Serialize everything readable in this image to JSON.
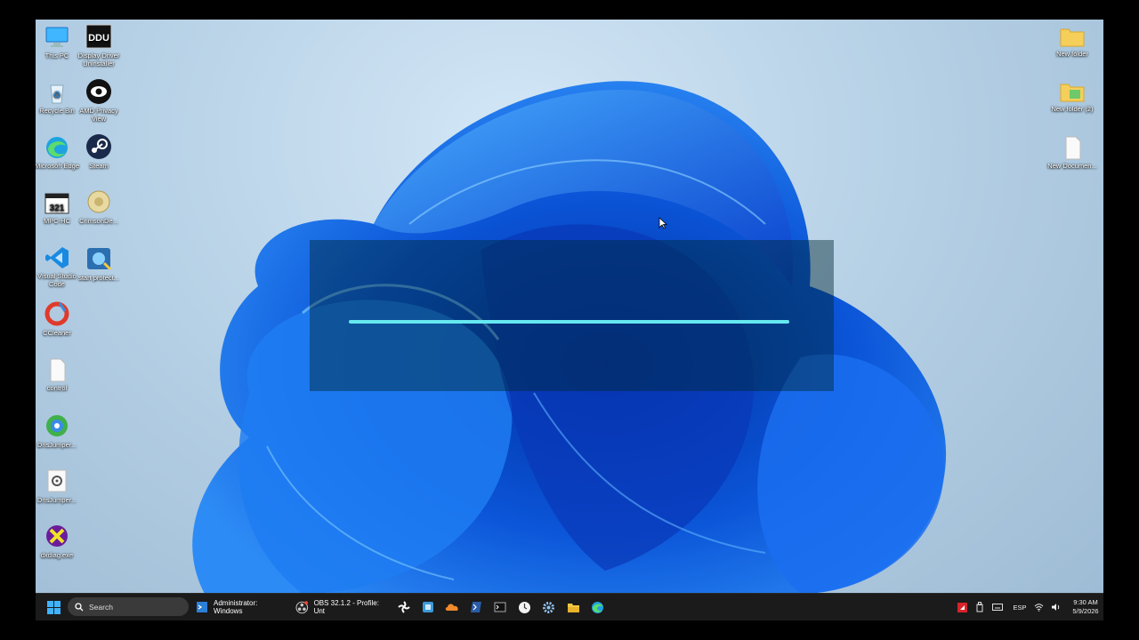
{
  "desktop": {
    "left_icons": [
      {
        "label": "This PC",
        "icon": "this-pc-icon"
      },
      {
        "label": "Display Driver Uninstaller",
        "icon": "display-driver-uninstaller-icon"
      },
      {
        "label": "Recycle Bin",
        "icon": "recycle-bin-icon"
      },
      {
        "label": "AMD Privacy View",
        "icon": "amd-privacy-view-icon"
      },
      {
        "label": "Microsoft Edge",
        "icon": "edge-icon"
      },
      {
        "label": "Steam",
        "icon": "steam-icon"
      },
      {
        "label": "MPC-HC",
        "icon": "mpc-hc-icon"
      },
      {
        "label": "CrimsonDe...",
        "icon": "crimson-icon"
      },
      {
        "label": "Visual Studio Code",
        "icon": "vscode-icon"
      },
      {
        "label": "start protect...",
        "icon": "start-protect-icon"
      },
      {
        "label": "CCleaner",
        "icon": "ccleaner-icon"
      },
      {
        "label": "control",
        "icon": "file-icon"
      },
      {
        "label": "DnsJumper...",
        "icon": "dnsjumper-icon"
      },
      {
        "label": "DnsJumper...",
        "icon": "dnsjumper-settings-icon"
      },
      {
        "label": "dxdiag.exe",
        "icon": "dxdiag-icon"
      }
    ],
    "right_icons": [
      {
        "label": "New folder",
        "icon": "folder-icon"
      },
      {
        "label": "New folder (2)",
        "icon": "folder-image-icon"
      },
      {
        "label": "New Documen...",
        "icon": "document-icon"
      }
    ],
    "progress_fraction": 1.0
  },
  "taskbar": {
    "search_placeholder": "Search",
    "apps": [
      {
        "label": "Administrator: Windows",
        "icon": "terminal-admin-icon"
      },
      {
        "label": "OBS 32.1.2 - Profile: Unt",
        "icon": "obs-icon"
      }
    ],
    "pinned_icons": [
      "fan-control-icon",
      "shield-app-icon",
      "cloud-icon",
      "powershell-icon",
      "cmd-icon",
      "clock-icon",
      "settings-icon",
      "file-explorer-icon",
      "edge-icon"
    ],
    "tray": {
      "language": "ESP",
      "time": "9:30 AM",
      "date": "5/9/2026"
    }
  },
  "colors": {
    "taskbar_bg": "#1b1b1b",
    "progress_bar": "#66e8f0",
    "wallpaper_blue": "#1565e8"
  }
}
